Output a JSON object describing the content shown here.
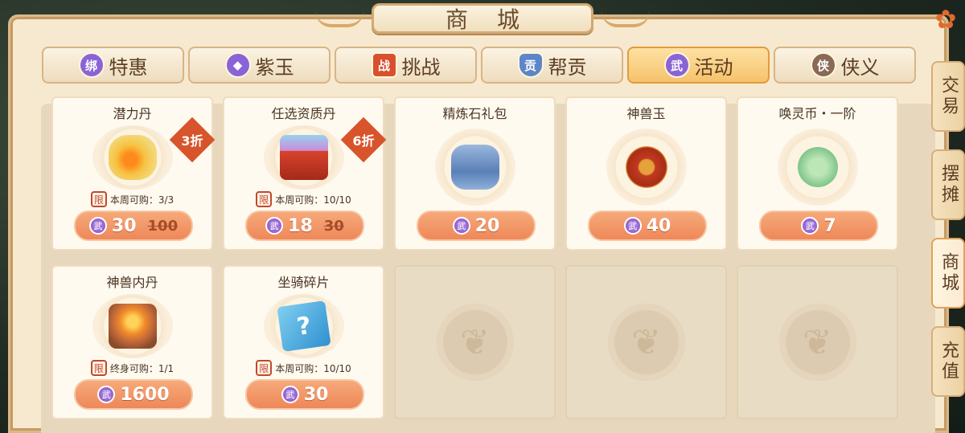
{
  "title": "商城",
  "tabs": [
    {
      "label": "特惠",
      "icon": "bound-gem-icon",
      "badge": "绑",
      "color": "#8a64d6",
      "active": false
    },
    {
      "label": "紫玉",
      "icon": "purple-gem-icon",
      "badge": "",
      "color": "#8a64d6",
      "active": false
    },
    {
      "label": "挑战",
      "icon": "challenge-token-icon",
      "badge": "战",
      "color": "#d9502f",
      "active": false
    },
    {
      "label": "帮贡",
      "icon": "guild-shield-icon",
      "badge": "贡",
      "color": "#5c86c9",
      "active": false
    },
    {
      "label": "活动",
      "icon": "martial-coin-icon",
      "badge": "武",
      "color": "#8a64d6",
      "active": true
    },
    {
      "label": "侠义",
      "icon": "chivalry-coin-icon",
      "badge": "侠",
      "color": "#8a6a55",
      "active": false
    }
  ],
  "side_tabs": [
    {
      "label": "交易",
      "active": false
    },
    {
      "label": "摆摊",
      "active": false
    },
    {
      "label": "商城",
      "active": true
    },
    {
      "label": "充值",
      "active": false
    }
  ],
  "items": [
    {
      "name": "潜力丹",
      "icon": "golden-pill-icon",
      "limit_badge": "限",
      "limit_text": "本周可购：3/3",
      "price": "30",
      "old_price": "100",
      "discount": "3折"
    },
    {
      "name": "任选资质丹",
      "icon": "treasure-chest-icon",
      "limit_badge": "限",
      "limit_text": "本周可购：10/10",
      "price": "18",
      "old_price": "30",
      "discount": "6折"
    },
    {
      "name": "精炼石礼包",
      "icon": "refining-stone-box-icon",
      "limit_badge": "",
      "limit_text": "",
      "price": "20",
      "old_price": "",
      "discount": ""
    },
    {
      "name": "神兽玉",
      "icon": "beast-jade-icon",
      "limit_badge": "",
      "limit_text": "",
      "price": "40",
      "old_price": "",
      "discount": ""
    },
    {
      "name": "唤灵币・一阶",
      "icon": "spirit-coin-icon",
      "limit_badge": "",
      "limit_text": "",
      "price": "7",
      "old_price": "",
      "discount": ""
    },
    {
      "name": "神兽内丹",
      "icon": "beast-core-icon",
      "limit_badge": "限",
      "limit_text": "终身可购：1/1",
      "price": "1600",
      "old_price": "",
      "discount": ""
    },
    {
      "name": "坐骑碎片",
      "icon": "mount-fragment-icon",
      "limit_badge": "限",
      "limit_text": "本周可购：10/10",
      "price": "30",
      "old_price": "",
      "discount": ""
    }
  ],
  "currency_badge": "武",
  "close_icon": "close-icon"
}
